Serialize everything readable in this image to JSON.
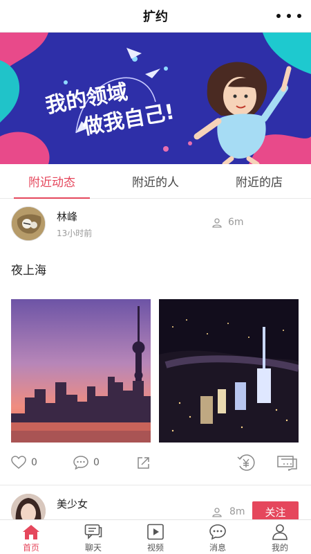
{
  "header": {
    "title": "扩约",
    "more_icon": "more-dots-icon"
  },
  "banner": {
    "line1": "我的领域",
    "line2": "做我自己!"
  },
  "tabs": [
    {
      "label": "附近动态",
      "active": true
    },
    {
      "label": "附近的人",
      "active": false
    },
    {
      "label": "附近的店",
      "active": false
    }
  ],
  "post": {
    "username": "林峰",
    "time": "13小时前",
    "distance": "6m",
    "text": "夜上海",
    "likes": "0",
    "comments": "0"
  },
  "post2": {
    "username": "美少女",
    "distance": "8m",
    "follow_label": "关注"
  },
  "nav": [
    {
      "label": "首页",
      "icon": "home-icon",
      "active": true
    },
    {
      "label": "聊天",
      "icon": "chat-icon",
      "active": false
    },
    {
      "label": "视频",
      "icon": "video-icon",
      "active": false
    },
    {
      "label": "消息",
      "icon": "message-icon",
      "active": false
    },
    {
      "label": "我的",
      "icon": "profile-icon",
      "active": false
    }
  ],
  "colors": {
    "accent": "#e5475c",
    "banner_bg": "#2e2fa8"
  }
}
